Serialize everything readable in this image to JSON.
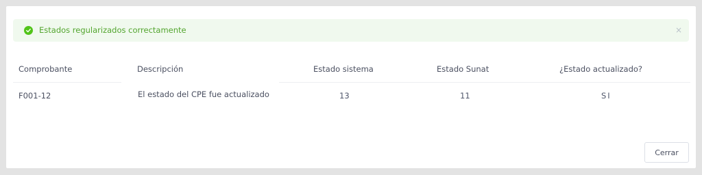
{
  "alert": {
    "message": "Estados regularizados correctamente",
    "close_symbol": "×",
    "icon": "check-circle-icon",
    "color": "#52c41a"
  },
  "table": {
    "headers": [
      "Comprobante",
      "Descripción",
      "Estado sistema",
      "Estado Sunat",
      "¿Estado actualizado?"
    ],
    "rows": [
      [
        "F001-12",
        "El estado del CPE fue actualizado",
        "13",
        "11",
        "SI"
      ]
    ]
  },
  "footer": {
    "close_label": "Cerrar"
  }
}
